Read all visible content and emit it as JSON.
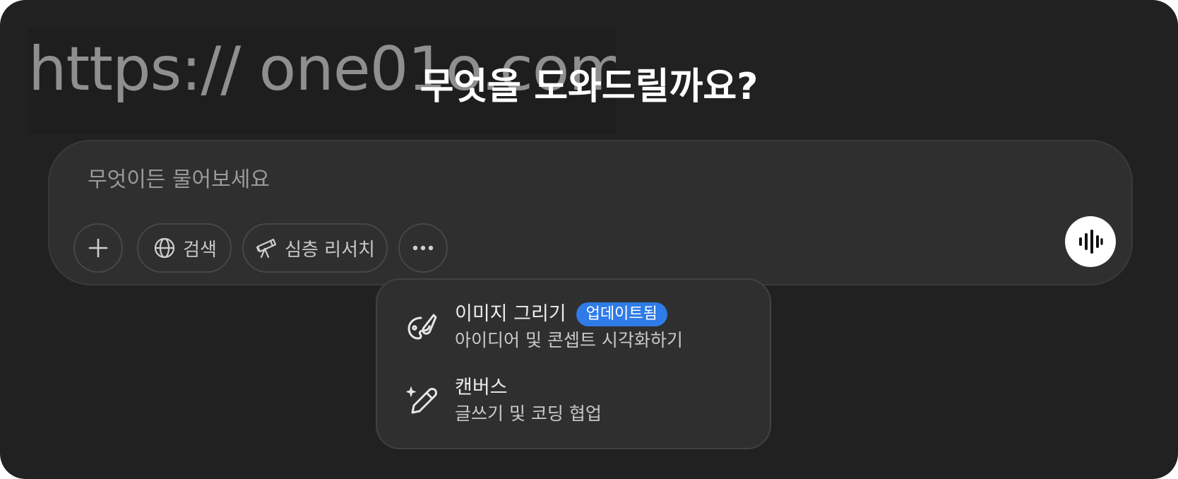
{
  "watermark": "https:// one01o.com",
  "headline": "무엇을 도와드릴까요?",
  "composer": {
    "placeholder": "무엇이든 물어보세요",
    "tools": {
      "plus_icon": "plus-icon",
      "search_label": "검색",
      "search_icon": "globe-icon",
      "research_label": "심층 리서치",
      "research_icon": "telescope-icon",
      "more_icon": "ellipsis-icon"
    },
    "voice_icon": "voice-waveform-icon"
  },
  "menu": {
    "items": [
      {
        "title": "이미지 그리기",
        "badge": "업데이트됨",
        "description": "아이디어 및 콘셉트 시각화하기",
        "icon": "palette-brush-icon"
      },
      {
        "title": "캔버스",
        "description": "글쓰기 및 코딩 협업",
        "icon": "sparkle-pen-icon"
      }
    ]
  },
  "colors": {
    "background": "#212121",
    "composer": "#2f2f2f",
    "badge": "#2f7be8",
    "text": "#ffffff"
  }
}
